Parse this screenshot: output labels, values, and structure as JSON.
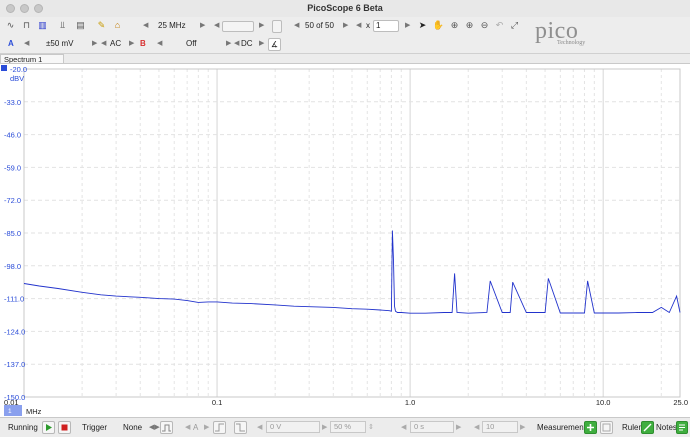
{
  "window": {
    "title": "PicoScope 6 Beta"
  },
  "toolbar": {
    "timebase": "25 MHz",
    "waveform_counter": "50 of 50",
    "zoom_prefix": "x",
    "zoom_value": "1"
  },
  "channel_a": {
    "label": "A",
    "range": "±50 mV",
    "coupling": "AC",
    "color": "#2a4cd8"
  },
  "channel_b": {
    "label": "B",
    "range": "Off",
    "coupling": "DC",
    "color": "#d83030"
  },
  "logo": {
    "brand": "pico",
    "tagline": "Technology"
  },
  "view": {
    "tab_label": "Spectrum 1"
  },
  "chart_data": {
    "type": "line",
    "title": "",
    "ylabel": "dBV",
    "xlabel": "MHz",
    "x_scale": "log",
    "xlim": [
      0.01,
      25.0
    ],
    "ylim": [
      -150.0,
      -20.0
    ],
    "y_ticks": [
      "-20.0",
      "-33.0",
      "-46.0",
      "-59.0",
      "-72.0",
      "-85.0",
      "-98.0",
      "-111.0",
      "-124.0",
      "-137.0",
      "-150.0"
    ],
    "x_ticks": [
      "0.01",
      "0.1",
      "1.0",
      "10.0",
      "25.0"
    ],
    "x_tick_values": [
      0.01,
      0.1,
      1.0,
      10.0,
      25.0
    ],
    "y_tick_values": [
      -20,
      -33,
      -46,
      -59,
      -72,
      -85,
      -98,
      -111,
      -124,
      -137,
      -150
    ],
    "grid": true,
    "series_color": "#2233cc",
    "series": [
      {
        "name": "A",
        "x": [
          0.01,
          0.012,
          0.015,
          0.02,
          0.025,
          0.03,
          0.04,
          0.05,
          0.06,
          0.07,
          0.08,
          0.09,
          0.1,
          0.12,
          0.15,
          0.2,
          0.25,
          0.3,
          0.4,
          0.5,
          0.6,
          0.7,
          0.78,
          0.8,
          0.81,
          0.82,
          0.83,
          0.84,
          0.86,
          0.9,
          1.0,
          1.2,
          1.5,
          1.65,
          1.7,
          1.75,
          2.0,
          2.5,
          2.6,
          3.0,
          3.3,
          3.4,
          4.0,
          5.0,
          5.2,
          6.0,
          7.0,
          8.0,
          8.3,
          9.0,
          10.0,
          12.0,
          15.0,
          18.0,
          20.0,
          22.0,
          24.0,
          25.0
        ],
        "y": [
          -105,
          -106,
          -107,
          -108.5,
          -109.5,
          -110,
          -110.5,
          -111,
          -111.2,
          -111.8,
          -112.5,
          -112.3,
          -112.3,
          -112.8,
          -113,
          -113.5,
          -114,
          -114.2,
          -114.5,
          -115,
          -115.2,
          -115.5,
          -115.8,
          -116,
          -84,
          -96,
          -114,
          -116,
          -116.5,
          -116.5,
          -116.8,
          -116.8,
          -116.5,
          -116.5,
          -101,
          -116.5,
          -116.8,
          -116.5,
          -104,
          -116.5,
          -116.5,
          -104.5,
          -116.5,
          -116.5,
          -103,
          -116.7,
          -116.7,
          -116.7,
          -104,
          -116.7,
          -116.7,
          -116.7,
          -116.5,
          -116.5,
          -114.5,
          -116.5,
          -110,
          -116.5
        ]
      }
    ]
  },
  "status": {
    "run_state": "Running",
    "trigger_label": "Trigger",
    "trigger_mode": "None",
    "trigger_channel": "A",
    "threshold": "0 V",
    "percent": "50 %",
    "delay": "0 s",
    "hold": "10",
    "measurements": "Measurements",
    "rulers": "Rulers",
    "notes": "Notes"
  }
}
